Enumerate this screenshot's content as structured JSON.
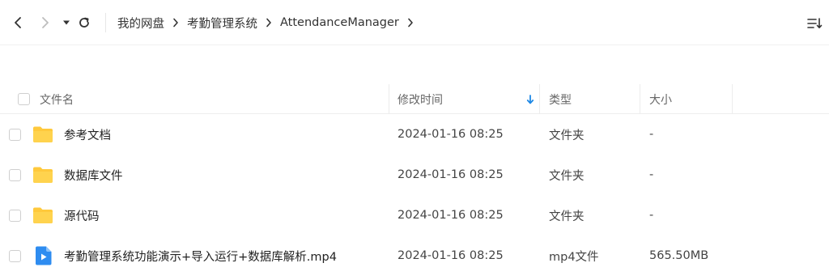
{
  "toolbar": {
    "breadcrumbs": [
      "我的网盘",
      "考勤管理系统",
      "AttendanceManager"
    ]
  },
  "columns": {
    "name": "文件名",
    "modified": "修改时间",
    "type": "类型",
    "size": "大小"
  },
  "sort": {
    "column": "modified",
    "direction": "descending"
  },
  "colors": {
    "folder": "#FFC93C",
    "video": "#2E8CF0",
    "sort_arrow": "#1E88E5"
  },
  "files": [
    {
      "name": "参考文档",
      "modified": "2024-01-16 08:25",
      "type": "文件夹",
      "size": "-",
      "icon": "folder-icon"
    },
    {
      "name": "数据库文件",
      "modified": "2024-01-16 08:25",
      "type": "文件夹",
      "size": "-",
      "icon": "folder-icon"
    },
    {
      "name": "源代码",
      "modified": "2024-01-16 08:25",
      "type": "文件夹",
      "size": "-",
      "icon": "folder-icon"
    },
    {
      "name": "考勤管理系统功能演示+导入运行+数据库解析.mp4",
      "modified": "2024-01-16 08:25",
      "type": "mp4文件",
      "size": "565.50MB",
      "icon": "video-file-icon"
    }
  ]
}
